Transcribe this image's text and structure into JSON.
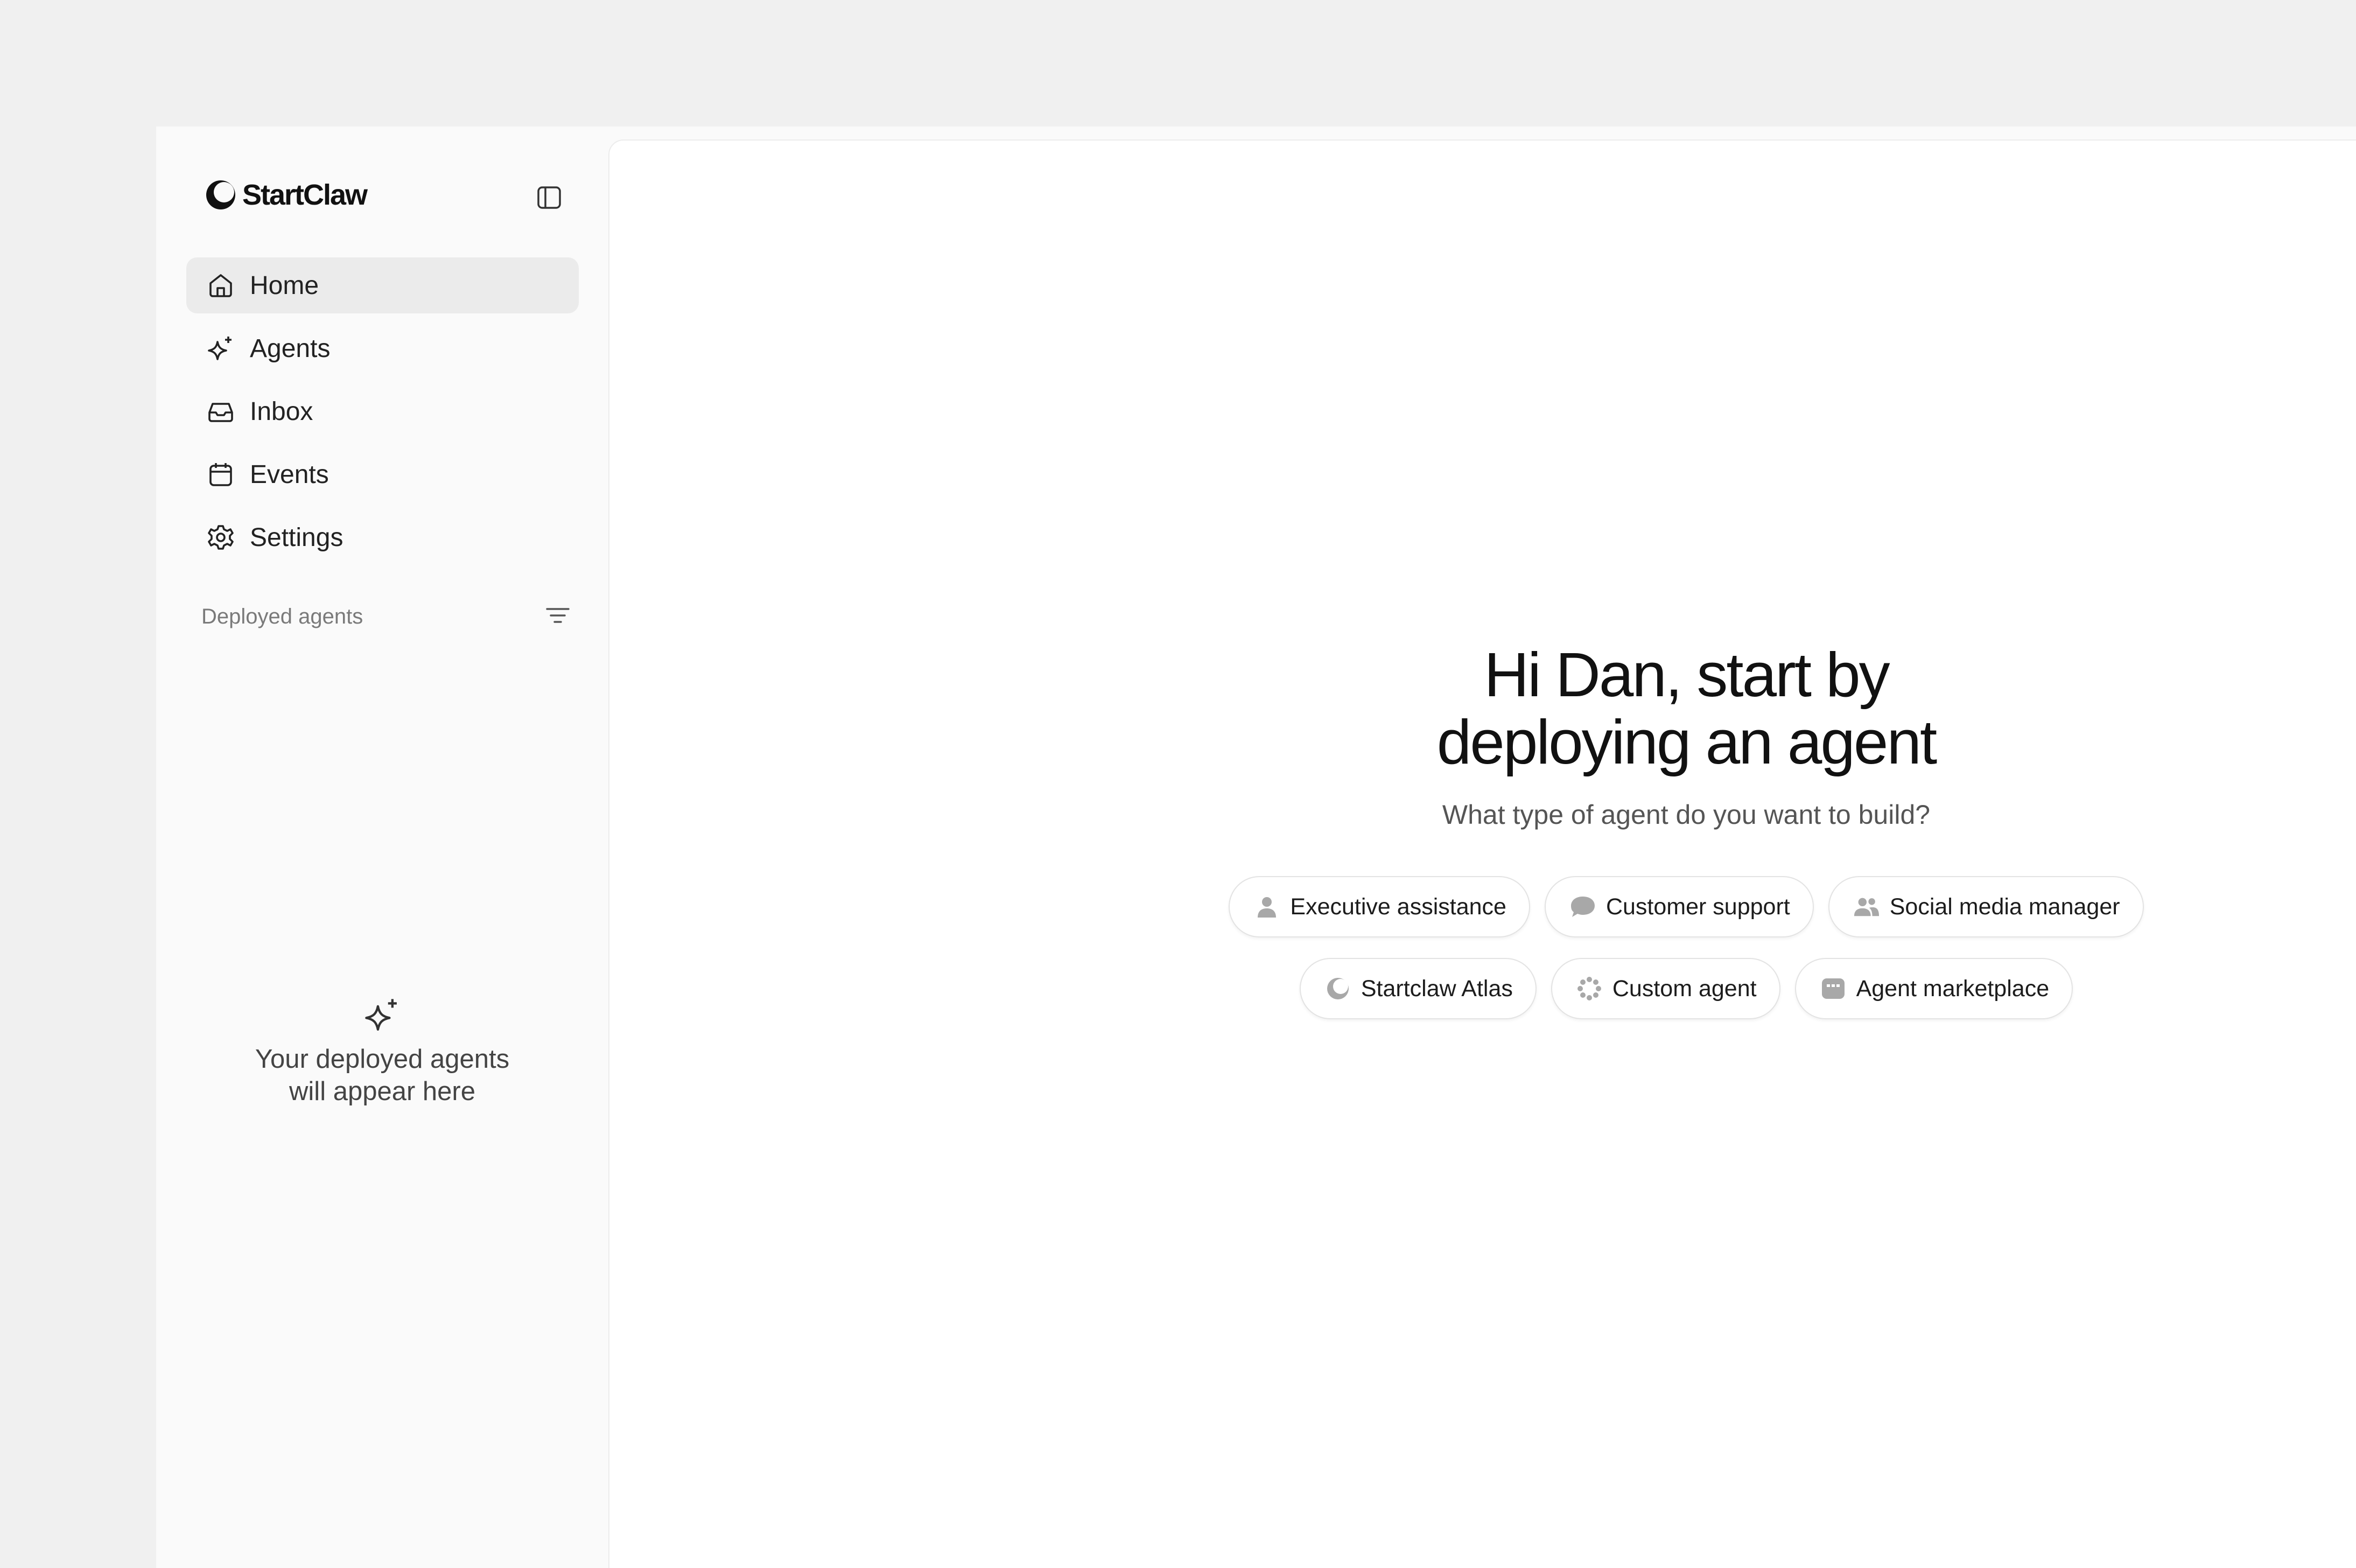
{
  "brand": {
    "name": "StartClaw",
    "logo_icon": "startclaw-logo-icon"
  },
  "sidebar": {
    "collapse_icon": "sidebar-toggle-icon",
    "nav": [
      {
        "label": "Home",
        "icon": "home-icon",
        "active": true
      },
      {
        "label": "Agents",
        "icon": "sparkle-icon",
        "active": false
      },
      {
        "label": "Inbox",
        "icon": "inbox-icon",
        "active": false
      },
      {
        "label": "Events",
        "icon": "calendar-icon",
        "active": false
      },
      {
        "label": "Settings",
        "icon": "gear-icon",
        "active": false
      }
    ],
    "section": {
      "title": "Deployed agents",
      "filter_icon": "filter-icon"
    },
    "empty_state": {
      "icon": "sparkle-icon",
      "line1": "Your deployed agents",
      "line2": "will appear here"
    }
  },
  "main": {
    "title_line1": "Hi Dan, start by",
    "title_line2": "deploying an agent",
    "subtitle": "What type of agent do you want to build?",
    "options_row1": [
      {
        "label": "Executive assistance",
        "icon": "person-icon"
      },
      {
        "label": "Customer support",
        "icon": "chat-bubble-icon"
      },
      {
        "label": "Social media manager",
        "icon": "users-icon"
      }
    ],
    "options_row2": [
      {
        "label": "Startclaw Atlas",
        "icon": "startclaw-logo-icon"
      },
      {
        "label": "Custom agent",
        "icon": "dots-circle-icon"
      },
      {
        "label": "Agent marketplace",
        "icon": "store-icon"
      }
    ]
  },
  "colors": {
    "page_bg": "#f0f0f0",
    "sidebar_bg": "#fafafa",
    "active_item_bg": "#ebebeb",
    "text_primary": "#111111",
    "text_muted": "#7a7a7a",
    "chip_icon": "#a8a8a8"
  }
}
